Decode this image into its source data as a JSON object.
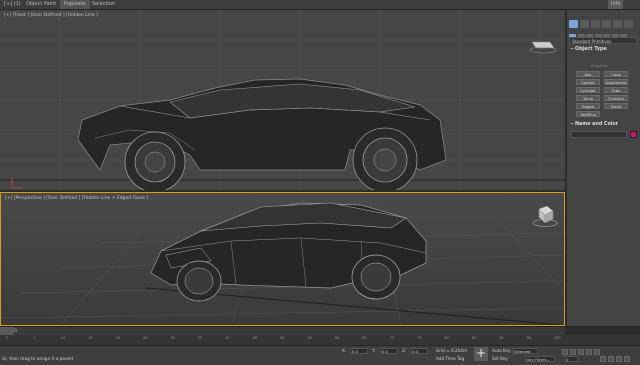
{
  "topbar": {
    "items": [
      "[+] (1)",
      "Object Paint",
      "Populate",
      "Selection"
    ],
    "right_label": "Info"
  },
  "viewports": {
    "front": {
      "label": "[+] [Front ] [User Defined ] [Hidden Line ]"
    },
    "perspective": {
      "label": "[+] [Perspective ] [User Defined ] [Hidden Line + Edged Faces ]"
    }
  },
  "command_panel": {
    "dropdown": "Standard Primitives",
    "object_type": {
      "title": "Object Type",
      "autogrid": "AutoGrid",
      "buttons": [
        "Box",
        "Cone",
        "Sphere",
        "GeoSphere",
        "Cylinder",
        "Tube",
        "Torus",
        "Pyramid",
        "Teapot",
        "Plane",
        "TextPlus"
      ]
    },
    "name_color": {
      "title": "Name and Color",
      "color": "#c8166f"
    }
  },
  "timeline": {
    "counter": "0 / 100"
  },
  "trackbar": {
    "ticks": [
      "0",
      "5",
      "10",
      "15",
      "20",
      "25",
      "30",
      "35",
      "40",
      "45",
      "50",
      "55",
      "60",
      "65",
      "70",
      "75",
      "80",
      "85",
      "90",
      "95",
      "100"
    ]
  },
  "status": {
    "prompt": "ck, then drag to assign it a parent",
    "x_label": "X:",
    "x_value": "0.0",
    "y_label": "Y:",
    "y_value": "0.0",
    "z_label": "Z:",
    "z_value": "0.0",
    "grid": "Grid = 0.254m",
    "add_time_tag": "Add Time Tag",
    "auto_key": "Auto Key",
    "set_key": "Set Key",
    "selected": "Selected",
    "key_filters": "Key Filters...",
    "frame": "0"
  }
}
